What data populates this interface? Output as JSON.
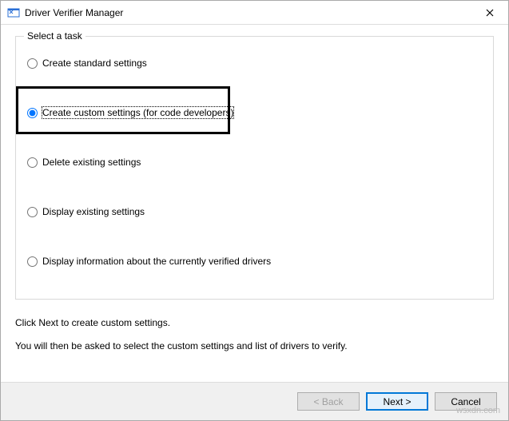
{
  "window": {
    "title": "Driver Verifier Manager"
  },
  "group": {
    "legend": "Select a task"
  },
  "options": {
    "r1": "Create standard settings",
    "r2": "Create custom settings (for code developers)",
    "r3": "Delete existing settings",
    "r4": "Display existing settings",
    "r5": "Display information about the currently verified drivers"
  },
  "selected": "r2",
  "instructions": {
    "line1": "Click Next to create custom settings.",
    "line2": "You will then be asked to select the custom settings and list of drivers to verify."
  },
  "buttons": {
    "back": "< Back",
    "next": "Next >",
    "cancel": "Cancel"
  },
  "watermark": "wsxdn.com"
}
